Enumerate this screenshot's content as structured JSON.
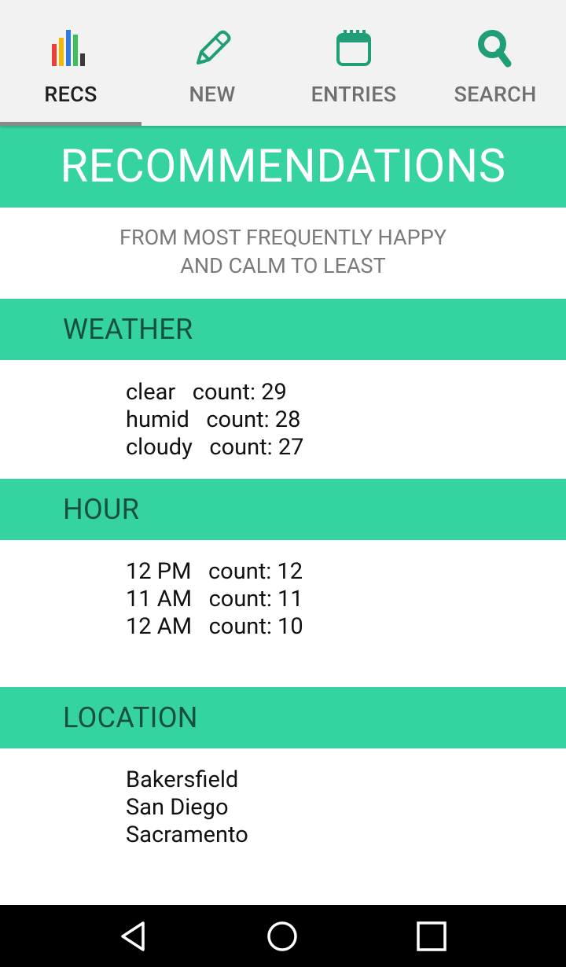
{
  "tabs": [
    {
      "label": "RECS",
      "icon": "bar-chart-icon",
      "active": true
    },
    {
      "label": "NEW",
      "icon": "pencil-icon",
      "active": false
    },
    {
      "label": "ENTRIES",
      "icon": "calendar-icon",
      "active": false
    },
    {
      "label": "SEARCH",
      "icon": "search-icon",
      "active": false
    }
  ],
  "title": "RECOMMENDATIONS",
  "subtitle": {
    "line1": "FROM MOST FREQUENTLY HAPPY",
    "line2": "AND CALM TO LEAST"
  },
  "sections": {
    "weather": {
      "heading": "WEATHER",
      "rows": [
        "clear   count: 29",
        "humid   count: 28",
        "cloudy   count: 27"
      ]
    },
    "hour": {
      "heading": "HOUR",
      "rows": [
        "12 PM   count: 12",
        "11 AM   count: 11",
        "12 AM   count: 10"
      ]
    },
    "location": {
      "heading": "LOCATION",
      "rows": [
        "Bakersfield",
        "San Diego",
        "Sacramento"
      ]
    }
  },
  "colors": {
    "accent": "#36d3a2",
    "header_text": "#16513f",
    "icon_green": "#1f9e78",
    "tabbar_bg": "#f2f2f2"
  },
  "navbar": {
    "icons": [
      "back-icon",
      "home-icon",
      "recents-icon"
    ]
  }
}
